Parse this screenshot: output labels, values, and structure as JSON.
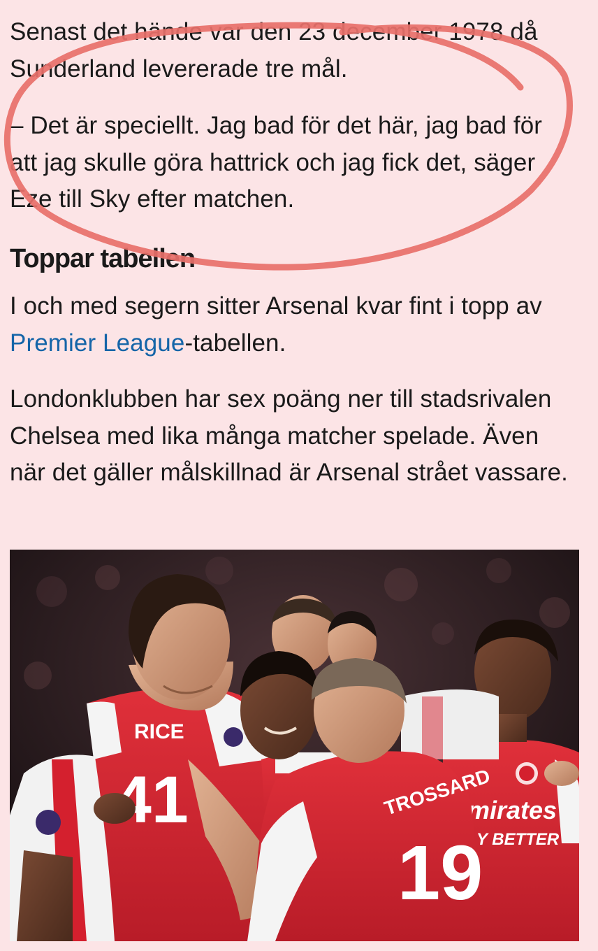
{
  "article": {
    "paragraph_1": "Senast det hände var den 23 december 1978 då Sunderland levererade tre mål.",
    "paragraph_2": "– Det är speciellt. Jag bad för det här, jag bad för att jag skulle göra hattrick och jag fick det, säger Eze till Sky efter matchen.",
    "heading": "Toppar tabellen",
    "paragraph_3_before": "I och med segern sitter Arsenal kvar fint i topp av ",
    "paragraph_3_link": "Premier League",
    "paragraph_3_after": "-tabellen.",
    "paragraph_4": "Londonklubben har sex poäng ner till stadsrivalen Chelsea med lika många matcher spelade. Även när det gäller målskillnad är Arsenal strået vassare."
  },
  "photo": {
    "jersey_name_left": "RICE",
    "jersey_number_left": "41",
    "jersey_name_center": "TROSSARD",
    "jersey_number_center": "19",
    "sponsor_line_1": "mirates",
    "sponsor_line_2": "Y BETTER"
  },
  "colors": {
    "background": "#fce4e6",
    "link": "#1565a8",
    "annotation_stroke": "#e8706a",
    "arsenal_red": "#d4202e"
  }
}
